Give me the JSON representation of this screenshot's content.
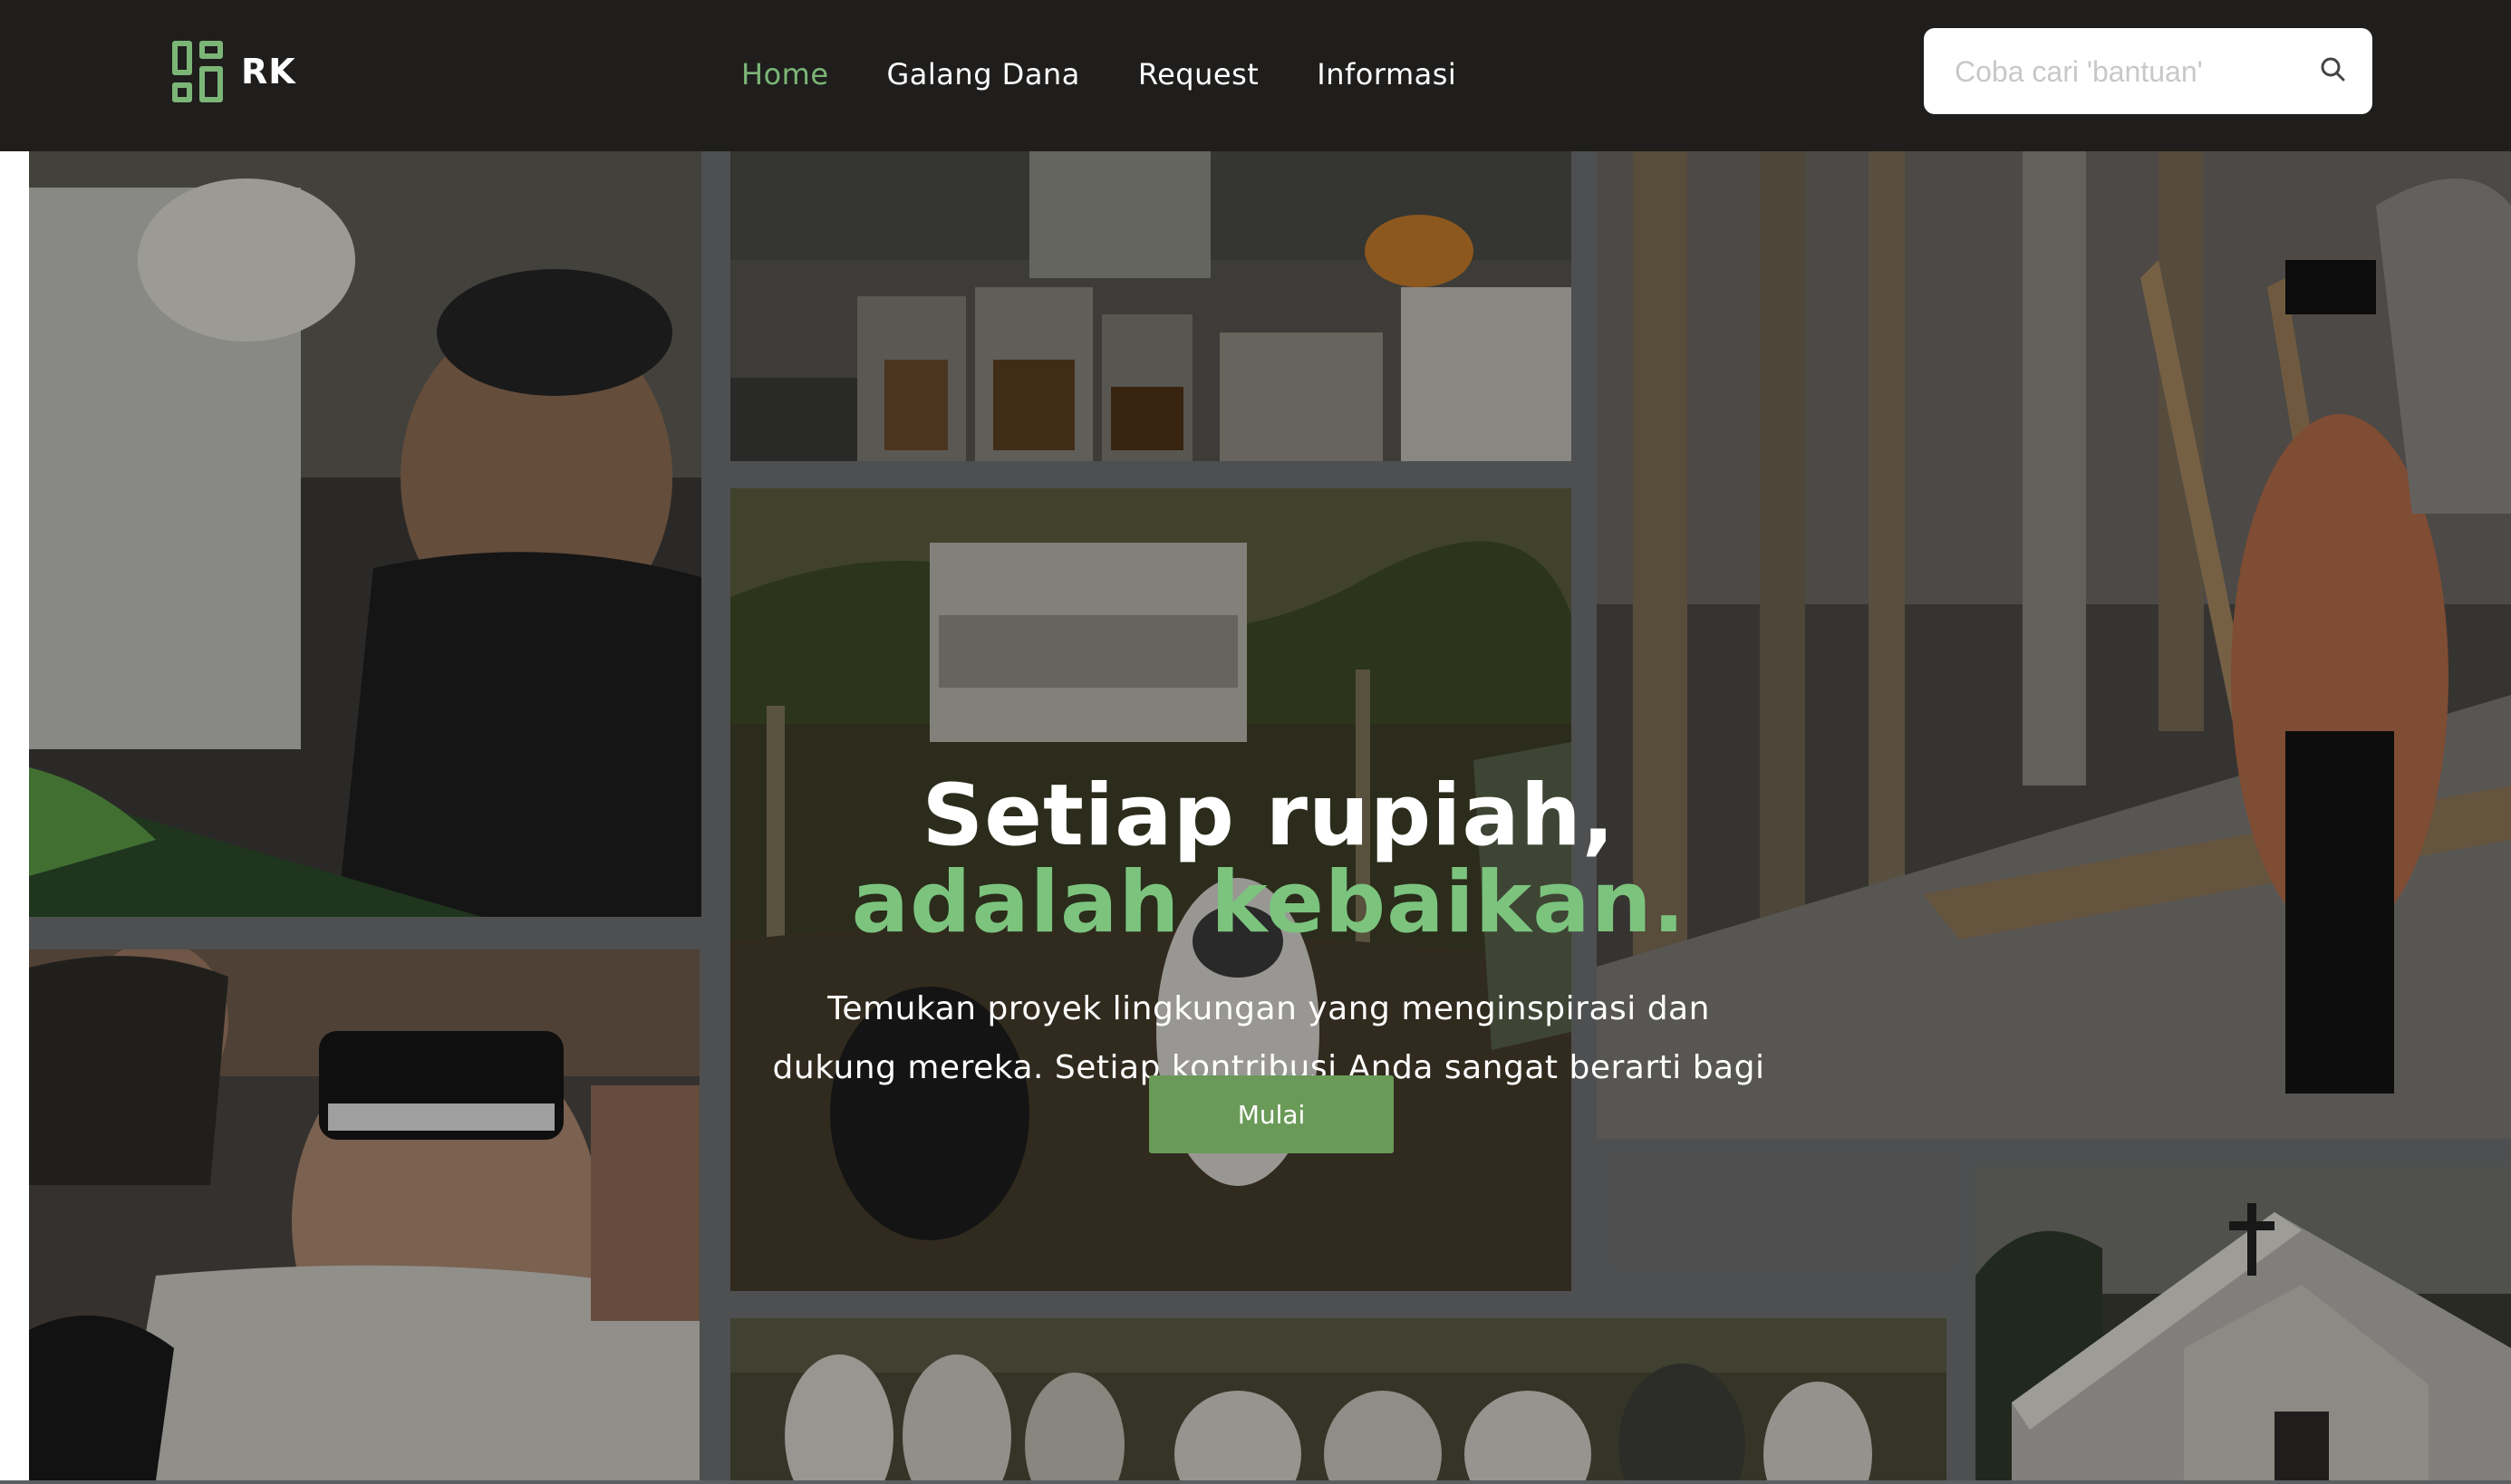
{
  "brand": {
    "name": "RK"
  },
  "nav": {
    "items": [
      {
        "label": "Home",
        "active": true
      },
      {
        "label": "Galang Dana",
        "active": false
      },
      {
        "label": "Request",
        "active": false
      },
      {
        "label": "Informasi",
        "active": false
      }
    ]
  },
  "search": {
    "placeholder": "Coba cari 'bantuan'",
    "icon": "search-icon"
  },
  "hero": {
    "headline_line1": "Setiap rupiah,",
    "headline_line2": "adalah kebaikan.",
    "subtitle": "Temukan proyek lingkungan yang menginspirasi dan dukung mereka. Setiap kontribusi Anda sangat berarti bagi mereka.",
    "cta_label": "Mulai"
  },
  "colors": {
    "navbar_bg": "#1f1e1d",
    "accent_green": "#7cb676",
    "headline_green": "#7cc47e",
    "cta_green": "#6a9a58"
  }
}
